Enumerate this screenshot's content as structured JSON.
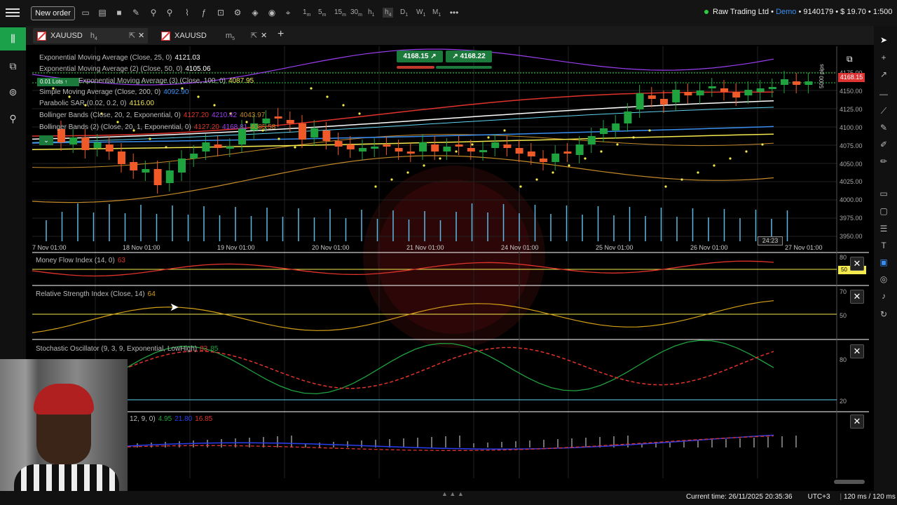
{
  "toolbar": {
    "new_order": "New order",
    "timeframes": [
      "1",
      "5",
      "15",
      "30",
      "1",
      "4",
      "D",
      "W",
      "M"
    ],
    "tf_suffix": [
      "m",
      "m",
      "m",
      "m",
      "h",
      "h",
      "",
      "",
      ""
    ]
  },
  "account": {
    "broker": "Raw Trading Ltd",
    "separator": " • ",
    "mode": "Demo",
    "info": " • 9140179 • $ 19.70 • 1:500"
  },
  "tabs": [
    {
      "symbol": "XAUUSD",
      "tf": "h",
      "tf_sub": "4"
    },
    {
      "symbol": "XAUUSD",
      "tf": "m",
      "tf_sub": "5"
    }
  ],
  "trade_panel": {
    "sell_price": "4168.15",
    "buy_price": "4168.22",
    "lots": "0.01 Lots"
  },
  "indicators_main": [
    {
      "label": "Exponential Moving Average (Close, 25, 0)",
      "value": "4121.03",
      "color": "#ffffff"
    },
    {
      "label": "Exponential Moving Average (2) (Close, 50, 0)",
      "value": "4105.06",
      "color": "#ffffff"
    },
    {
      "label": "Exponential Moving Average (3) (Close, 100, 0)",
      "value": "4087.95",
      "color": "#f4e94d"
    },
    {
      "label": "Simple Moving Average (Close, 200, 0)",
      "value": "4092.90",
      "color": "#3a8ef0"
    },
    {
      "label": "Parabolic SAR (0.02, 0.2, 0)",
      "value": "4116.00",
      "color": "#f4e94d"
    },
    {
      "label": "Bollinger Bands (Close, 20, 2, Exponential, 0)",
      "values": [
        "4127.20",
        "4210.42",
        "4043.97"
      ],
      "colors": [
        "#e0332b",
        "#9b3ef0",
        "#c48a2a"
      ]
    },
    {
      "label": "Bollinger Bands (2) (Close, 20, 1, Exponential, 0)",
      "values": [
        "4127.20",
        "4168.81",
        "4085.58"
      ],
      "colors": [
        "#e0332b",
        "#9b3ef0",
        "#c48a2a"
      ]
    }
  ],
  "price_axis": [
    "4175.00",
    "4150.00",
    "4125.00",
    "4100.00",
    "4075.00",
    "4050.00",
    "4025.00",
    "4000.00",
    "3975.00",
    "3950.00"
  ],
  "current_price": "4168.15",
  "pips_label": "5000 pips",
  "countdown": "24:23",
  "dates": [
    "7 Nov 01:00",
    "18 Nov 01:00",
    "19 Nov 01:00",
    "20 Nov 01:00",
    "21 Nov 01:00",
    "24 Nov 01:00",
    "25 Nov 01:00",
    "26 Nov 01:00",
    "27 Nov 01:00"
  ],
  "sub_indicators": {
    "mfi": {
      "label": "Money Flow Index (14, 0)",
      "value": "63",
      "levels": [
        "80",
        "50"
      ]
    },
    "rsi": {
      "label": "Relative Strength Index (Close, 14)",
      "value": "64",
      "levels": [
        "70",
        "50"
      ]
    },
    "stoch": {
      "label": "Stochastic Oscillator (9, 3, 9, Exponential, LowHigh)",
      "value1": "83",
      "value2": "85",
      "levels": [
        "80",
        "20"
      ]
    },
    "macd": {
      "label": "12, 9, 0)",
      "value1": "4.95",
      "value2": "21.80",
      "value3": "16.85"
    }
  },
  "status": {
    "current_time_label": "Current time:",
    "current_time": "26/11/2025 20:35:36",
    "timezone": "UTC+3",
    "latency": "120 ms / 120 ms"
  },
  "colors": {
    "bull": "#1fa33f",
    "bear": "#f05a28",
    "accent": "#1aa14a"
  }
}
